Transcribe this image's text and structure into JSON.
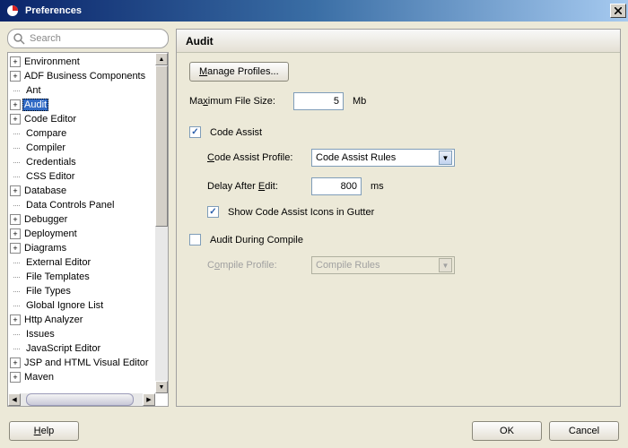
{
  "window": {
    "title": "Preferences"
  },
  "search": {
    "placeholder": "Search"
  },
  "tree": {
    "items": [
      {
        "label": "Environment",
        "expandable": true,
        "level": 0
      },
      {
        "label": "ADF Business Components",
        "expandable": true,
        "level": 0
      },
      {
        "label": "Ant",
        "expandable": false,
        "level": 1
      },
      {
        "label": "Audit",
        "expandable": true,
        "level": 0,
        "selected": true
      },
      {
        "label": "Code Editor",
        "expandable": true,
        "level": 0
      },
      {
        "label": "Compare",
        "expandable": false,
        "level": 1
      },
      {
        "label": "Compiler",
        "expandable": false,
        "level": 1
      },
      {
        "label": "Credentials",
        "expandable": false,
        "level": 1
      },
      {
        "label": "CSS Editor",
        "expandable": false,
        "level": 1
      },
      {
        "label": "Database",
        "expandable": true,
        "level": 0
      },
      {
        "label": "Data Controls Panel",
        "expandable": false,
        "level": 1
      },
      {
        "label": "Debugger",
        "expandable": true,
        "level": 0
      },
      {
        "label": "Deployment",
        "expandable": true,
        "level": 0
      },
      {
        "label": "Diagrams",
        "expandable": true,
        "level": 0
      },
      {
        "label": "External Editor",
        "expandable": false,
        "level": 1
      },
      {
        "label": "File Templates",
        "expandable": false,
        "level": 1
      },
      {
        "label": "File Types",
        "expandable": false,
        "level": 1
      },
      {
        "label": "Global Ignore List",
        "expandable": false,
        "level": 1
      },
      {
        "label": "Http Analyzer",
        "expandable": true,
        "level": 0
      },
      {
        "label": "Issues",
        "expandable": false,
        "level": 1
      },
      {
        "label": "JavaScript Editor",
        "expandable": false,
        "level": 1
      },
      {
        "label": "JSP and HTML Visual Editor",
        "expandable": true,
        "level": 0
      },
      {
        "label": "Maven",
        "expandable": true,
        "level": 0
      }
    ]
  },
  "panel": {
    "title": "Audit",
    "manage_profiles": "Manage Profiles...",
    "max_file_label_pre": "Ma",
    "max_file_label_u": "x",
    "max_file_label_post": "imum File Size:",
    "max_file_value": "5",
    "max_file_unit": "Mb",
    "code_assist_checked": true,
    "code_assist_label": "Code Assist",
    "code_assist_profile_label_u": "C",
    "code_assist_profile_label_post": "ode Assist Profile:",
    "code_assist_profile_value": "Code Assist Rules",
    "delay_label_pre": "Delay After ",
    "delay_label_u": "E",
    "delay_label_post": "dit:",
    "delay_value": "800",
    "delay_unit": "ms",
    "show_icons_checked": true,
    "show_icons_label": "Show Code Assist Icons in Gutter",
    "audit_compile_checked": false,
    "audit_compile_label": "Audit During Compile",
    "compile_profile_label_pre": "C",
    "compile_profile_label_u": "o",
    "compile_profile_label_post": "mpile Profile:",
    "compile_profile_value": "Compile Rules"
  },
  "footer": {
    "help": "Help",
    "ok": "OK",
    "cancel": "Cancel"
  }
}
